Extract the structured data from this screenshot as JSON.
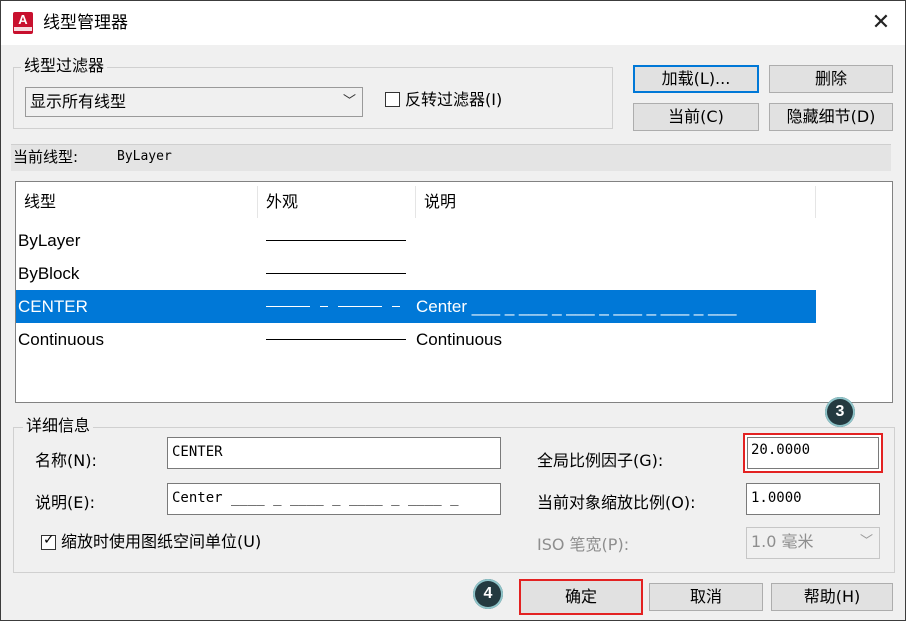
{
  "window": {
    "title": "线型管理器"
  },
  "filter": {
    "legend": "线型过滤器",
    "selected": "显示所有线型",
    "invert_label": "反转过滤器(I)"
  },
  "buttons": {
    "load": "加载(L)...",
    "delete": "删除",
    "current": "当前(C)",
    "hide_details": "隐藏细节(D)",
    "ok": "确定",
    "cancel": "取消",
    "help": "帮助(H)"
  },
  "current_linetype": {
    "label": "当前线型:",
    "value": "ByLayer"
  },
  "table": {
    "headers": [
      "线型",
      "外观",
      "说明"
    ],
    "rows": [
      {
        "name": "ByLayer",
        "appearance": "solid",
        "description": ""
      },
      {
        "name": "ByBlock",
        "appearance": "solid",
        "description": ""
      },
      {
        "name": "CENTER",
        "appearance": "center",
        "description": "Center ___ _ ___ _ ___ _ ___ _ ___ _ ___",
        "selected": true
      },
      {
        "name": "Continuous",
        "appearance": "solid",
        "description": "Continuous"
      }
    ]
  },
  "details": {
    "legend": "详细信息",
    "name_label": "名称(N):",
    "name_value": "CENTER",
    "desc_label": "说明(E):",
    "desc_value": "Center ____ _ ____ _ ____ _ ____ _",
    "paper_space_label": "缩放时使用图纸空间单位(U)",
    "global_scale_label": "全局比例因子(G):",
    "global_scale_value": "20.0000",
    "object_scale_label": "当前对象缩放比例(O):",
    "object_scale_value": "1.0000",
    "iso_pen_label": "ISO 笔宽(P):",
    "iso_pen_value": "1.0 毫米"
  },
  "annotations": {
    "step3": "3",
    "step4": "4"
  },
  "colors": {
    "selection": "#0078d7",
    "highlight": "#e32222",
    "accent": "#c8102e"
  }
}
